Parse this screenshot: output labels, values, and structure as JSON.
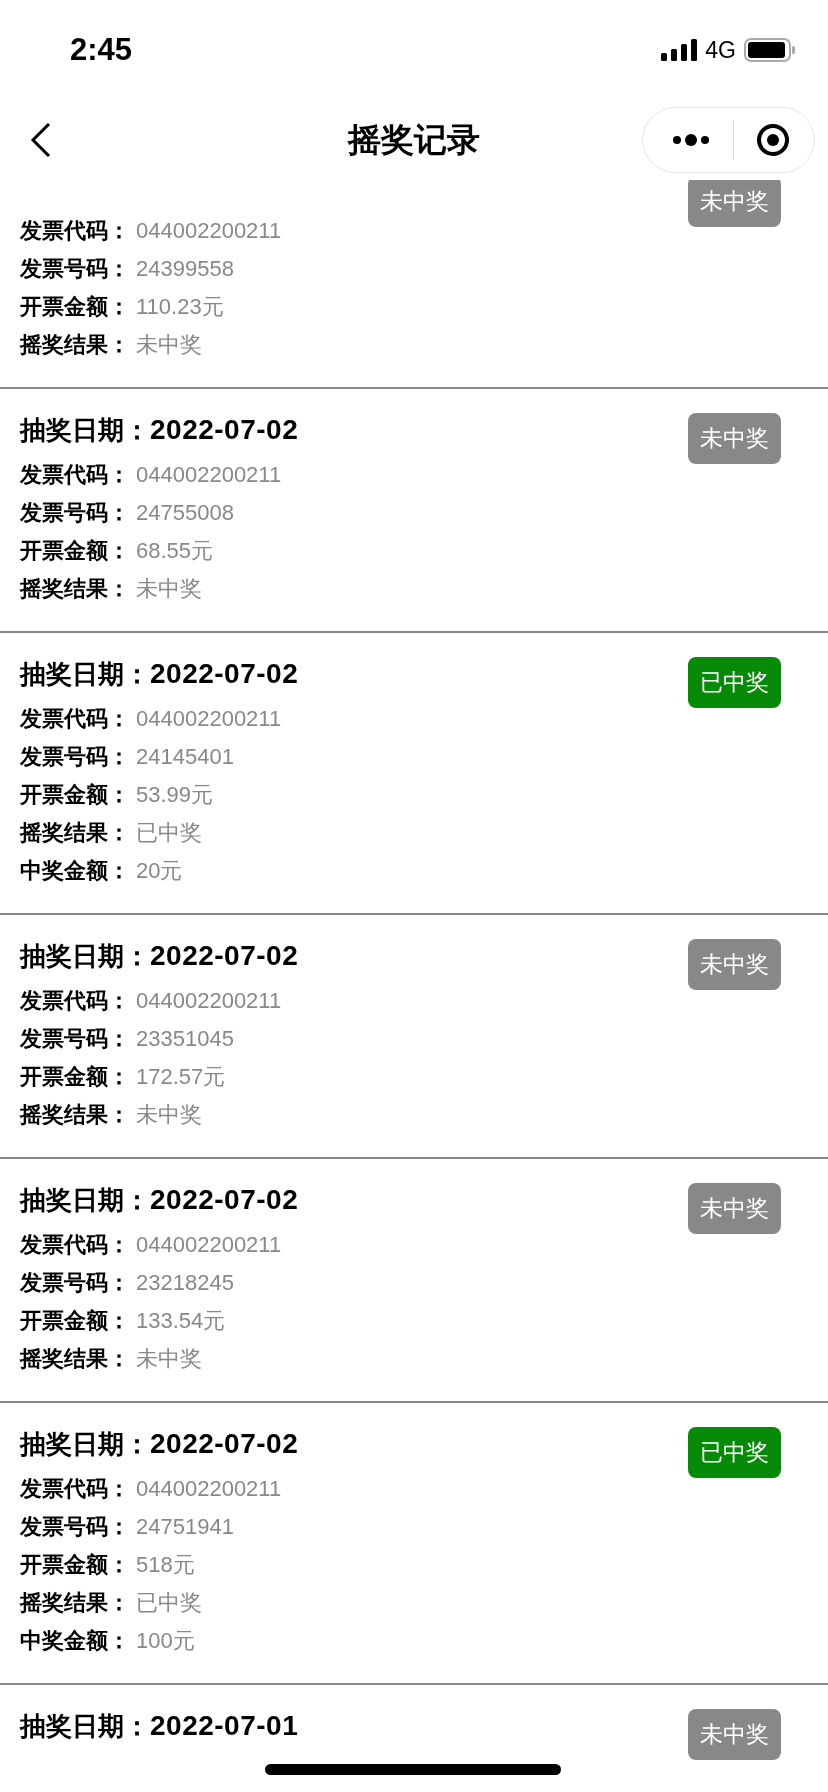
{
  "status_bar": {
    "time": "2:45",
    "network": "4G"
  },
  "nav": {
    "title": "摇奖记录"
  },
  "records": [
    {
      "badge": "未中奖",
      "won": false,
      "fields": [
        {
          "label": "发票代码：",
          "value": "044002200211"
        },
        {
          "label": "发票号码：",
          "value": "24399558"
        },
        {
          "label": "开票金额：",
          "value": "110.23元"
        },
        {
          "label": "摇奖结果：",
          "value": "未中奖"
        }
      ]
    },
    {
      "date_label": "抽奖日期：",
      "date": "2022-07-02",
      "badge": "未中奖",
      "won": false,
      "fields": [
        {
          "label": "发票代码：",
          "value": "044002200211"
        },
        {
          "label": "发票号码：",
          "value": "24755008"
        },
        {
          "label": "开票金额：",
          "value": "68.55元"
        },
        {
          "label": "摇奖结果：",
          "value": "未中奖"
        }
      ]
    },
    {
      "date_label": "抽奖日期：",
      "date": "2022-07-02",
      "badge": "已中奖",
      "won": true,
      "fields": [
        {
          "label": "发票代码：",
          "value": "044002200211"
        },
        {
          "label": "发票号码：",
          "value": "24145401"
        },
        {
          "label": "开票金额：",
          "value": "53.99元"
        },
        {
          "label": "摇奖结果：",
          "value": "已中奖"
        },
        {
          "label": "中奖金额：",
          "value": "20元"
        }
      ]
    },
    {
      "date_label": "抽奖日期：",
      "date": "2022-07-02",
      "badge": "未中奖",
      "won": false,
      "fields": [
        {
          "label": "发票代码：",
          "value": "044002200211"
        },
        {
          "label": "发票号码：",
          "value": "23351045"
        },
        {
          "label": "开票金额：",
          "value": "172.57元"
        },
        {
          "label": "摇奖结果：",
          "value": "未中奖"
        }
      ]
    },
    {
      "date_label": "抽奖日期：",
      "date": "2022-07-02",
      "badge": "未中奖",
      "won": false,
      "fields": [
        {
          "label": "发票代码：",
          "value": "044002200211"
        },
        {
          "label": "发票号码：",
          "value": "23218245"
        },
        {
          "label": "开票金额：",
          "value": "133.54元"
        },
        {
          "label": "摇奖结果：",
          "value": "未中奖"
        }
      ]
    },
    {
      "date_label": "抽奖日期：",
      "date": "2022-07-02",
      "badge": "已中奖",
      "won": true,
      "fields": [
        {
          "label": "发票代码：",
          "value": "044002200211"
        },
        {
          "label": "发票号码：",
          "value": "24751941"
        },
        {
          "label": "开票金额：",
          "value": "518元"
        },
        {
          "label": "摇奖结果：",
          "value": "已中奖"
        },
        {
          "label": "中奖金额：",
          "value": "100元"
        }
      ]
    },
    {
      "date_label": "抽奖日期：",
      "date": "2022-07-01",
      "badge": "未中奖",
      "won": false
    }
  ]
}
